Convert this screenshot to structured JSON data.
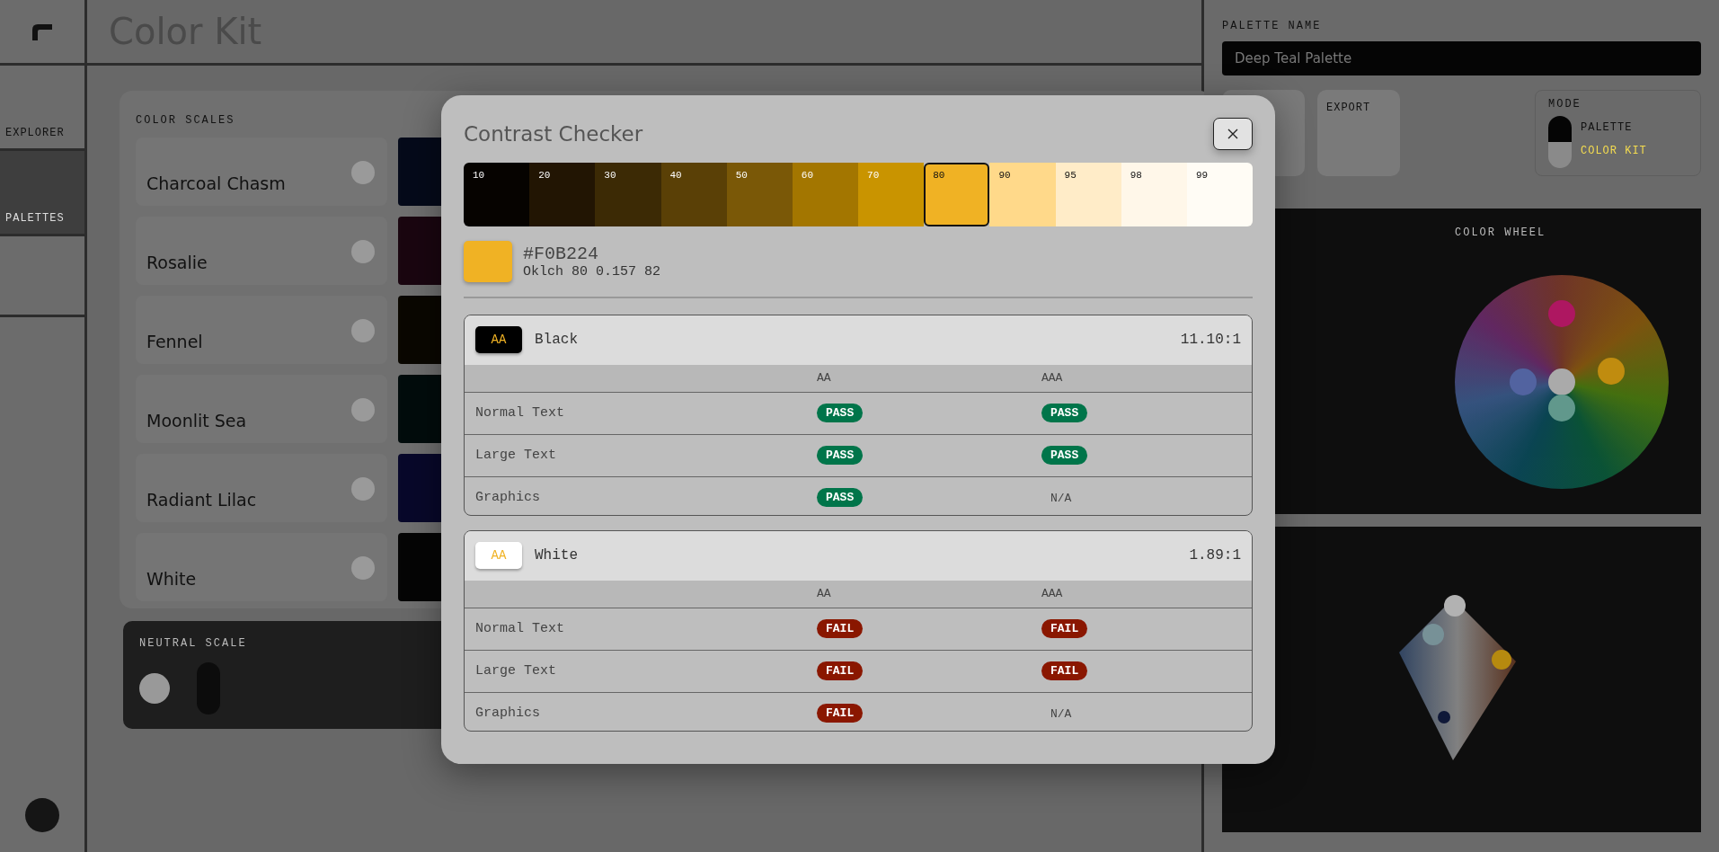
{
  "app": {
    "title": "Color Kit",
    "nav": [
      {
        "label": "EXPLORER",
        "selected": false
      },
      {
        "label": "PALETTES",
        "selected": true
      }
    ],
    "scales_section": {
      "label": "COLOR SCALES",
      "scales": [
        {
          "name": "Charcoal Chasm",
          "color": "#050a1a"
        },
        {
          "name": "Rosalie",
          "color": "#1a0610"
        },
        {
          "name": "Fennel",
          "color": "#0a0700"
        },
        {
          "name": "Moonlit Sea",
          "color": "#020c0c"
        },
        {
          "name": "Radiant Lilac",
          "color": "#08082a"
        },
        {
          "name": "White",
          "color": "#050505"
        }
      ]
    },
    "neutral": {
      "label": "NEUTRAL SCALE",
      "on": false
    },
    "palette_name": {
      "label": "PALETTE NAME",
      "value": "Deep Teal Palette"
    },
    "export_button": {
      "label": "EXPORT"
    },
    "mode": {
      "label": "MODE",
      "switch_on": true,
      "options": [
        {
          "label": "PALETTE",
          "selected": false
        },
        {
          "label": "COLOR KIT",
          "selected": true
        }
      ]
    },
    "color_wheel": {
      "label": "COLOR WHEEL"
    }
  },
  "modal": {
    "title": "Contrast Checker",
    "swatches": [
      {
        "label": "10",
        "color": "#060300",
        "selected": false
      },
      {
        "label": "20",
        "color": "#221503",
        "selected": false
      },
      {
        "label": "30",
        "color": "#3c2a05",
        "selected": false
      },
      {
        "label": "40",
        "color": "#5a4006",
        "selected": false
      },
      {
        "label": "50",
        "color": "#7a5807",
        "selected": false
      },
      {
        "label": "60",
        "color": "#a37600",
        "selected": false
      },
      {
        "label": "70",
        "color": "#c99400",
        "selected": false
      },
      {
        "label": "80",
        "color": "#f0b224",
        "selected": true
      },
      {
        "label": "90",
        "color": "#ffd98a",
        "selected": false
      },
      {
        "label": "95",
        "color": "#ffecc8",
        "selected": false
      },
      {
        "label": "98",
        "color": "#fff7e9",
        "selected": false
      },
      {
        "label": "99",
        "color": "#fffcf5",
        "selected": false
      }
    ],
    "current": {
      "hex": "#F0B224",
      "oklch": "Oklch 80 0.157 82"
    },
    "checks": [
      {
        "badge": "AA",
        "color": "#000000",
        "name": "Black",
        "ratio": "11.10:1",
        "columns": [
          "AA",
          "AAA"
        ],
        "rows": [
          {
            "label": "Normal Text",
            "results": [
              {
                "kind": "pass",
                "text": "PASS"
              },
              {
                "kind": "pass",
                "text": "PASS"
              }
            ]
          },
          {
            "label": "Large Text",
            "results": [
              {
                "kind": "pass",
                "text": "PASS"
              },
              {
                "kind": "pass",
                "text": "PASS"
              }
            ]
          },
          {
            "label": "Graphics",
            "results": [
              {
                "kind": "pass",
                "text": "PASS"
              },
              {
                "kind": "na",
                "text": "N/A"
              }
            ]
          }
        ]
      },
      {
        "badge": "AA",
        "color": "#ffffff",
        "name": "White",
        "ratio": "1.89:1",
        "columns": [
          "AA",
          "AAA"
        ],
        "rows": [
          {
            "label": "Normal Text",
            "results": [
              {
                "kind": "fail",
                "text": "FAIL"
              },
              {
                "kind": "fail",
                "text": "FAIL"
              }
            ]
          },
          {
            "label": "Large Text",
            "results": [
              {
                "kind": "fail",
                "text": "FAIL"
              },
              {
                "kind": "fail",
                "text": "FAIL"
              }
            ]
          },
          {
            "label": "Graphics",
            "results": [
              {
                "kind": "fail",
                "text": "FAIL"
              },
              {
                "kind": "na",
                "text": "N/A"
              }
            ]
          }
        ]
      }
    ]
  }
}
